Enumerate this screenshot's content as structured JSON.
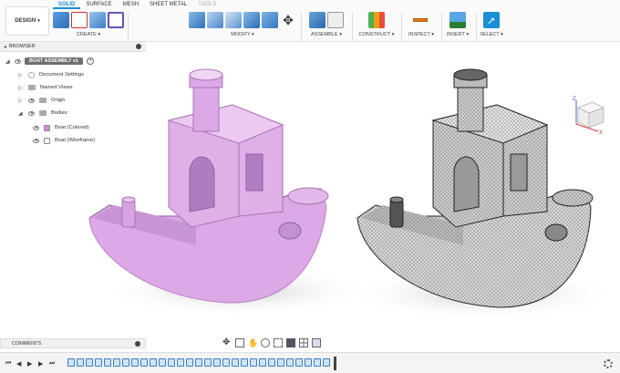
{
  "workspace": {
    "label": "DESIGN"
  },
  "tabs": [
    {
      "label": "SOLID",
      "active": true
    },
    {
      "label": "SURFACE"
    },
    {
      "label": "MESH"
    },
    {
      "label": "SHEET METAL"
    },
    {
      "label": "TOOLS",
      "dim": true
    }
  ],
  "groups": {
    "create": "CREATE",
    "modify": "MODIFY",
    "assemble": "ASSEMBLE",
    "construct": "CONSTRUCT",
    "inspect": "INSPECT",
    "insert": "INSERT",
    "select": "SELECT"
  },
  "browser": {
    "title": "BROWSER",
    "assembly": "BOAT ASSEMBLY v1",
    "items": [
      {
        "label": "Document Settings",
        "icon": "gear-icon"
      },
      {
        "label": "Named Views",
        "icon": "folder-icon"
      },
      {
        "label": "Origin",
        "icon": "folder-icon"
      },
      {
        "label": "Bodies",
        "icon": "folder-icon"
      }
    ],
    "bodies": [
      {
        "label": "Boat (Colored)",
        "swatch": "#d988e0"
      },
      {
        "label": "Boat (Wireframe)",
        "swatch": "#ffffff"
      }
    ]
  },
  "comments": {
    "title": "COMMENTS"
  },
  "viewcube": {
    "axis_x": "X",
    "axis_y": "Y",
    "axis_z": "Z"
  },
  "colors": {
    "accent": "#1a8fd8",
    "boat_colored": "#dca8e6",
    "boat_colored_shadow": "#b57fc2",
    "boat_wire": "#d6d6d6"
  }
}
